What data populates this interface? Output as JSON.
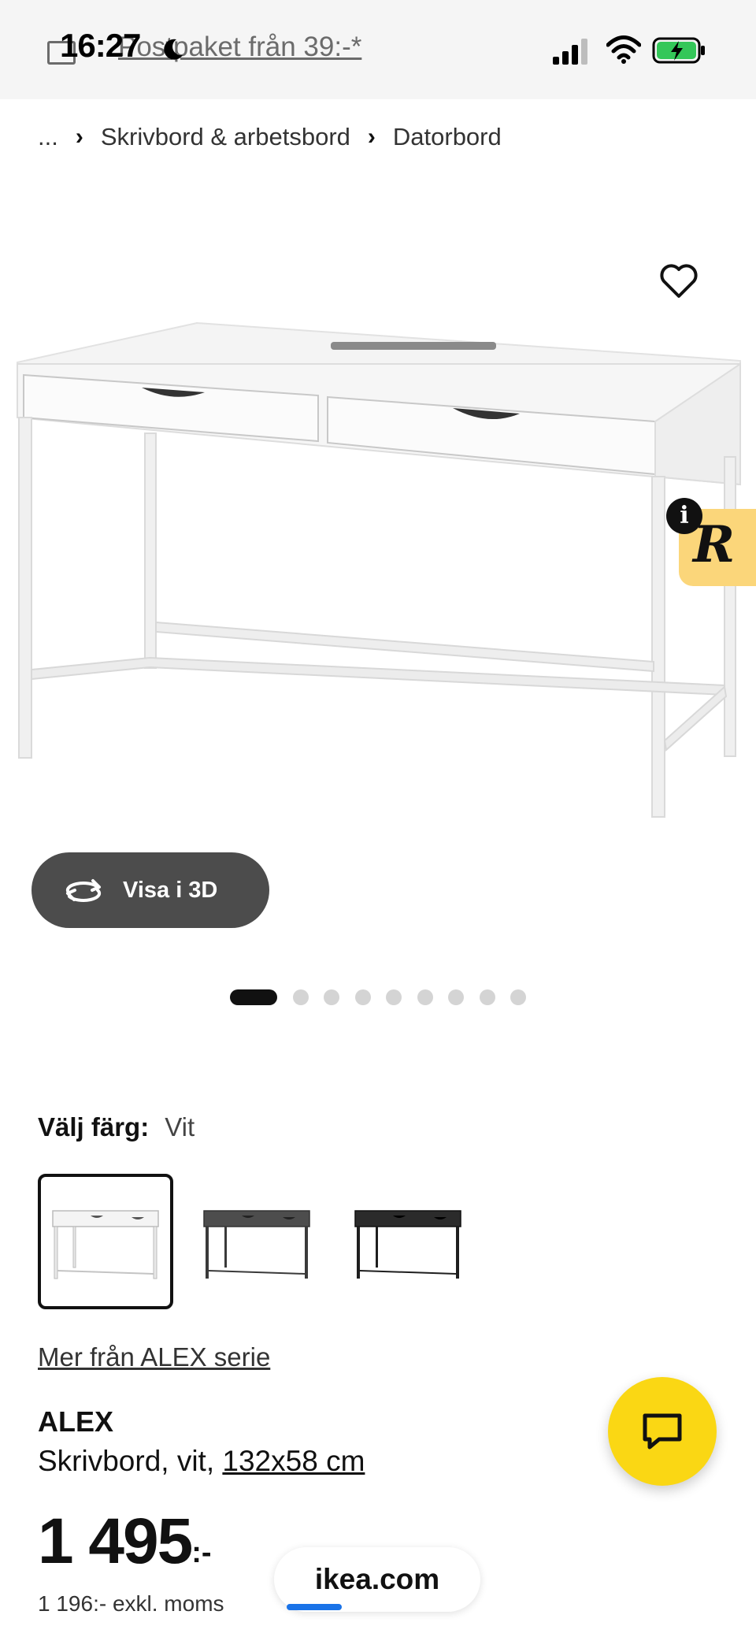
{
  "status_bar": {
    "time": "16:27",
    "promo_text": "Postpaket från 39:-*"
  },
  "breadcrumb": {
    "items": [
      "...",
      "Skrivbord & arbetsbord",
      "Datorbord"
    ]
  },
  "gallery": {
    "view_3d_label": "Visa i 3D",
    "dots_total": 9,
    "dots_active_index": 0
  },
  "info_badge": {
    "info_glyph": "i",
    "letter": "R"
  },
  "color_select": {
    "label": "Välj färg:",
    "value": "Vit",
    "options": [
      "white",
      "dark-grey",
      "black"
    ],
    "selected_index": 0
  },
  "product": {
    "series_link": "Mer från ALEX serie",
    "name": "ALEX",
    "description": "Skrivbord, vit, ",
    "dimensions": "132x58 cm",
    "price_main": "1 495",
    "price_suffix": ":-",
    "price_excl_vat": "1 196:- exkl. moms"
  },
  "browser": {
    "url": "ikea.com"
  },
  "colors": {
    "accent_yellow": "#fad714",
    "badge_yellow": "#fbd67a",
    "button_dark": "#4c4c4c",
    "progress_blue": "#1a73e8"
  },
  "icons": [
    "moon-icon",
    "signal-icon",
    "wifi-icon",
    "battery-charging-icon",
    "heart-icon",
    "rotate-3d-icon",
    "chat-icon",
    "info-icon",
    "package-icon"
  ]
}
